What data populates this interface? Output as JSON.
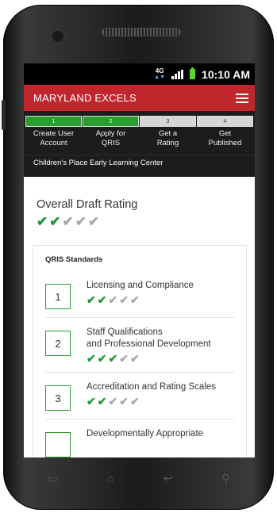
{
  "statusbar": {
    "network": "4G",
    "time": "10:10 AM"
  },
  "app": {
    "brand": "MARYLAND EXCELS"
  },
  "steps": [
    {
      "number": "1",
      "label_line1": "Create User",
      "label_line2": "Account",
      "state": "done"
    },
    {
      "number": "2",
      "label_line1": "Apply for",
      "label_line2": "QRIS",
      "state": "done"
    },
    {
      "number": "3",
      "label_line1": "Get a",
      "label_line2": "Rating",
      "state": "todo"
    },
    {
      "number": "4",
      "label_line1": "Get",
      "label_line2": "Published",
      "state": "todo"
    }
  ],
  "center_name": "Children's Place Early Learning Center",
  "overall": {
    "title": "Overall Draft Rating",
    "rating": 2,
    "max": 5
  },
  "standards": {
    "title": "QRIS Standards",
    "items": [
      {
        "number": "1",
        "name_line1": "Licensing and Compliance",
        "name_line2": "",
        "rating": 2
      },
      {
        "number": "2",
        "name_line1": "Staff Qualifications",
        "name_line2": "and Professional Development",
        "rating": 3
      },
      {
        "number": "3",
        "name_line1": "Accreditation and Rating Scales",
        "name_line2": "",
        "rating": 2
      },
      {
        "number": "",
        "name_line1": "Developmentally Appropriate",
        "name_line2": "",
        "rating": 0
      }
    ]
  },
  "colors": {
    "brand_red": "#c0272d",
    "check_green": "#1e9a34",
    "check_gray": "#a9a9a9",
    "step_done": "#2a9d2f"
  },
  "nav_icons": [
    "menu-icon",
    "home-icon",
    "back-icon",
    "search-icon"
  ]
}
